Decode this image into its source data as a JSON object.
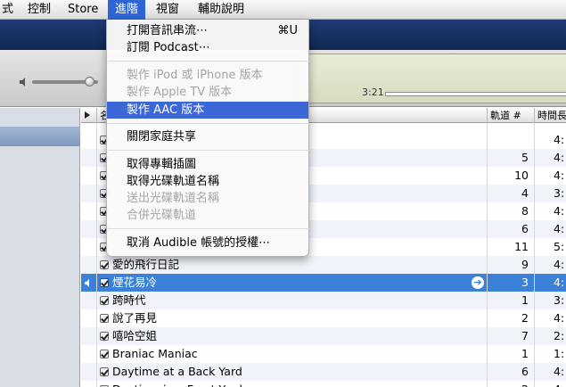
{
  "menubar": {
    "items": [
      "式",
      "控制",
      "Store",
      "進階",
      "視窗",
      "輔助說明"
    ],
    "active_index": 3
  },
  "lcd": {
    "elapsed": "3:21"
  },
  "table": {
    "headers": {
      "name": "名",
      "track": "軌道 #",
      "time": "時間長"
    },
    "rows": [
      {
        "name": "",
        "track": "",
        "time": "4:"
      },
      {
        "name": "",
        "track": "5",
        "time": "4:"
      },
      {
        "name": "",
        "track": "10",
        "time": "4:"
      },
      {
        "name": "",
        "track": "4",
        "time": "3:"
      },
      {
        "name": "",
        "track": "8",
        "time": "4:"
      },
      {
        "name": "",
        "track": "6",
        "time": "4:"
      },
      {
        "name": "",
        "track": "11",
        "time": "5:"
      },
      {
        "name": "愛的飛行日記",
        "track": "9",
        "time": "4:"
      },
      {
        "name": "煙花易冷",
        "track": "3",
        "time": "4:"
      },
      {
        "name": "跨時代",
        "track": "1",
        "time": "3:"
      },
      {
        "name": "說了再見",
        "track": "2",
        "time": "4:"
      },
      {
        "name": "嘻哈空姐",
        "track": "7",
        "time": "2:"
      },
      {
        "name": "Braniac Maniac",
        "track": "1",
        "time": "1:"
      },
      {
        "name": "Daytime at a Back Yard",
        "track": "6",
        "time": "4:"
      },
      {
        "name": "Daytime in a Front Yard",
        "track": "2",
        "time": "4:"
      }
    ]
  },
  "menu": {
    "items": [
      {
        "label": "打開音訊串流⋯",
        "shortcut": "⌘U",
        "enabled": true
      },
      {
        "label": "訂閱 Podcast⋯",
        "shortcut": "",
        "enabled": true
      },
      {
        "label": "製作 iPod 或 iPhone 版本",
        "shortcut": "",
        "enabled": false
      },
      {
        "label": "製作 Apple TV 版本",
        "shortcut": "",
        "enabled": false
      },
      {
        "label": "製作 AAC 版本",
        "shortcut": "",
        "enabled": true,
        "highlighted": true
      },
      {
        "label": "關閉家庭共享",
        "shortcut": "",
        "enabled": true
      },
      {
        "label": "取得專輯插圖",
        "shortcut": "",
        "enabled": true
      },
      {
        "label": "取得光碟軌道名稱",
        "shortcut": "",
        "enabled": true
      },
      {
        "label": "送出光碟軌道名稱",
        "shortcut": "",
        "enabled": false
      },
      {
        "label": "合併光碟軌道",
        "shortcut": "",
        "enabled": false
      },
      {
        "label": "取消 Audible 帳號的授權⋯",
        "shortcut": "",
        "enabled": true
      }
    ]
  },
  "colors": {
    "menu_highlight": "#3b67d8",
    "row_selected": "#3c81d8",
    "menubar_active": "#2f64d6"
  },
  "icons": [
    "speaker-low-icon",
    "now-playing-speaker-icon",
    "go-arrow-icon",
    "sort-arrow-icon",
    "checkbox-icon"
  ]
}
